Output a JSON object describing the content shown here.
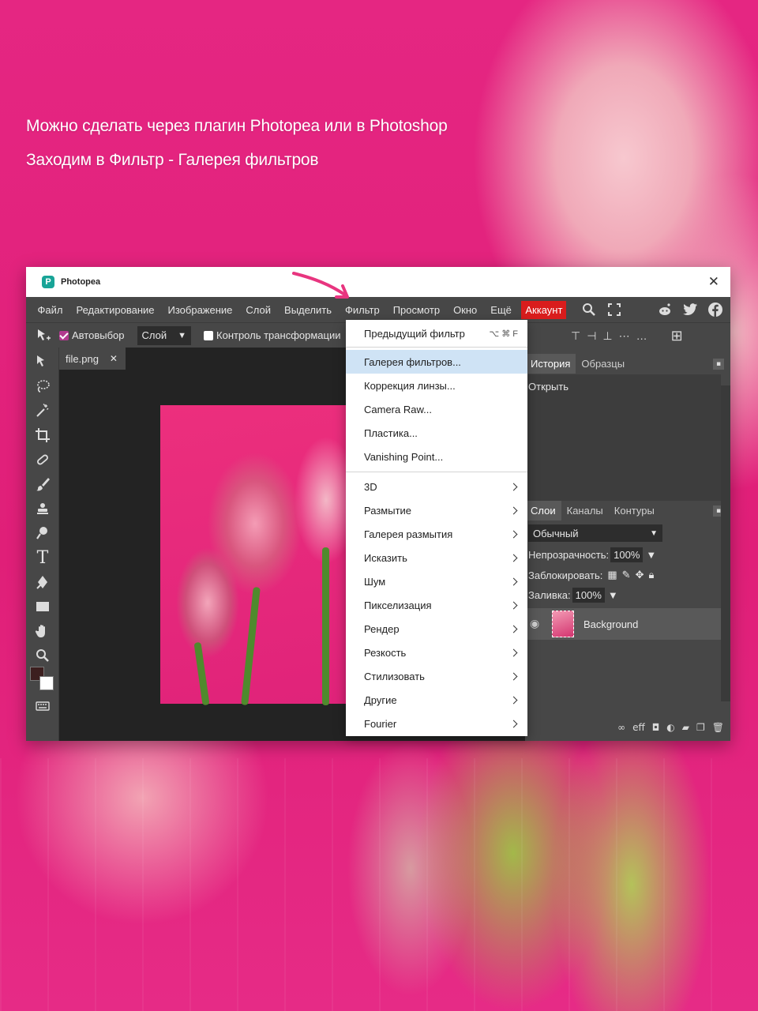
{
  "headline": {
    "line1": "Можно сделать через плагин  Photopea или в Photoshop",
    "line2": "Заходим в Фильтр - Галерея фильтров"
  },
  "window": {
    "title": "Photopea",
    "logo_letter": "P",
    "close_glyph": "✕"
  },
  "menubar": {
    "items": [
      "Файл",
      "Редактирование",
      "Изображение",
      "Слой",
      "Выделить",
      "Фильтр",
      "Просмотр",
      "Окно",
      "Ещё"
    ],
    "account_label": "Аккаунт"
  },
  "options": {
    "autoselect_label": "Автовыбор",
    "autoselect_checked": true,
    "layer_select_value": "Слой",
    "transform_label": "Контроль трансформации"
  },
  "document": {
    "tab_label": "file.png",
    "tab_close": "✕"
  },
  "panels": {
    "top_tabs": [
      "История",
      "Образцы"
    ],
    "history_item": "Открыть",
    "layer_tabs": [
      "Слои",
      "Каналы",
      "Контуры"
    ],
    "blend_mode": "Обычный",
    "opacity_label": "Непрозрачность:",
    "opacity_value": "100%",
    "lock_label": "Заблокировать:",
    "fill_label": "Заливка:",
    "fill_value": "100%",
    "layer_name": "Background",
    "footer_label": "eff"
  },
  "filter_menu": {
    "previous_filter": "Предыдущий фильтр",
    "previous_shortcut": "⌥ ⌘ F",
    "group1": [
      "Галерея фильтров...",
      "Коррекция линзы...",
      "Camera Raw...",
      "Пластика...",
      "Vanishing Point..."
    ],
    "highlighted": "Галерея фильтров...",
    "submenus": [
      "3D",
      "Размытие",
      "Галерея размытия",
      "Исказить",
      "Шум",
      "Пикселизация",
      "Рендер",
      "Резкость",
      "Стилизовать",
      "Другие",
      "Fourier"
    ]
  },
  "colors": {
    "background_pink": "#e2237a",
    "account_red": "#d91c1c",
    "highlight_blue": "#cfe3f5",
    "foreground_swatch": "#3c1f1f",
    "background_swatch": "#ffffff"
  }
}
